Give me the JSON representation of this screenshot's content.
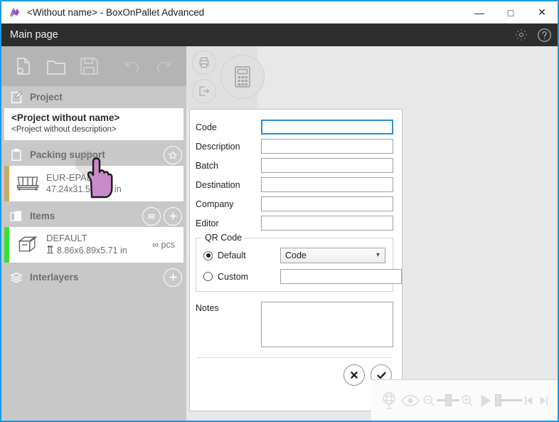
{
  "window": {
    "title": "<Without name> - BoxOnPallet Advanced",
    "logo_icon": "app-logo-icon",
    "minimize": "—",
    "maximize": "□",
    "close": "✕"
  },
  "menustrip": {
    "label": "Main page",
    "settings_icon": "gear-icon",
    "help_icon": "help-icon"
  },
  "file_toolbar": {
    "new_icon": "new-project-icon",
    "open_icon": "open-folder-icon",
    "save_icon": "save-disk-icon",
    "undo_icon": "undo-arrow-icon",
    "redo_icon": "redo-arrow-icon"
  },
  "action_bar": {
    "print_icon": "print-icon",
    "export_icon": "export-icon",
    "calculate_icon": "calculator-icon"
  },
  "sidebar": {
    "project": {
      "header": "Project",
      "icon": "project-edit-icon",
      "name": "<Project without name>",
      "description": "<Project without description>"
    },
    "packing_support": {
      "header": "Packing support",
      "icon": "packing-support-icon",
      "favorite_icon": "star-icon",
      "item": {
        "title": "EUR-EPAL",
        "dimensions": "47.24x31.5x5.67 in",
        "icon": "pallet-icon",
        "accent_color": "#c8a96a"
      }
    },
    "items": {
      "header": "Items",
      "icon": "items-icon",
      "menu_icon": "hamburger-menu-icon",
      "add_icon": "plus-icon",
      "item": {
        "title": "DEFAULT",
        "dimensions": "8.86x6.89x5.71 in",
        "dimension_icon": "height-arrows-icon",
        "quantity": "∞ pcs",
        "icon": "box-icon",
        "accent_color": "#38e038"
      }
    },
    "interlayers": {
      "header": "Interlayers",
      "icon": "interlayers-icon",
      "add_icon": "plus-icon"
    }
  },
  "form": {
    "fields": [
      {
        "label": "Code",
        "value": "",
        "focused": true
      },
      {
        "label": "Description",
        "value": "",
        "focused": false
      },
      {
        "label": "Batch",
        "value": "",
        "focused": false
      },
      {
        "label": "Destination",
        "value": "",
        "focused": false
      },
      {
        "label": "Company",
        "value": "",
        "focused": false
      },
      {
        "label": "Editor",
        "value": "",
        "focused": false
      }
    ],
    "qr_code": {
      "title": "QR Code",
      "default_label": "Default",
      "default_selected": true,
      "default_value": "Code",
      "custom_label": "Custom",
      "custom_selected": false,
      "custom_value": "",
      "dropdown_icon": "chevron-down-icon"
    },
    "notes": {
      "label": "Notes",
      "value": ""
    },
    "cancel_icon": "cancel-x-icon",
    "confirm_icon": "confirm-check-icon"
  },
  "bottom_toolbar": {
    "globe_icon": "globe-icon",
    "view_icon": "eye-icon",
    "zoom_out_icon": "zoom-out-icon",
    "zoom_in_icon": "zoom-in-icon",
    "zoom_slider_value": 25,
    "play_icon": "play-icon",
    "anim_slider_value": 8,
    "step_back_icon": "step-back-icon",
    "step_forward_icon": "step-forward-icon"
  },
  "cursor": {
    "icon": "pointing-hand-cursor",
    "color": "#c88ac8"
  },
  "colors": {
    "window_border": "#1a9ae0",
    "menustrip_bg": "#2d2d30",
    "sidebar_bg": "#c8c8c8",
    "toolbar_bg": "#b4b4b4",
    "canvas_bg": "#e8e8e8",
    "focus_blue": "#2a8ed6"
  }
}
